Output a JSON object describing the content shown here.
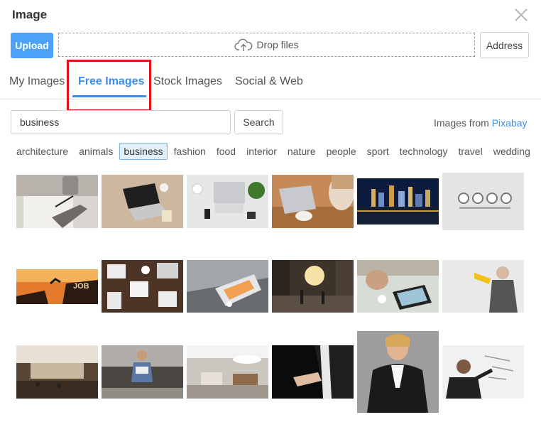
{
  "dialog": {
    "title": "Image"
  },
  "toolbar": {
    "upload_label": "Upload",
    "drop_label": "Drop files",
    "address_label": "Address"
  },
  "tabs": [
    {
      "label": "My Images"
    },
    {
      "label": "Free Images"
    },
    {
      "label": "Stock Images"
    },
    {
      "label": "Social & Web"
    }
  ],
  "active_tab": "Free Images",
  "search": {
    "value": "business",
    "button_label": "Search",
    "source_prefix": "Images from",
    "source_name": "Pixabay"
  },
  "categories": [
    "architecture",
    "animals",
    "business",
    "fashion",
    "food",
    "interior",
    "nature",
    "people",
    "sport",
    "technology",
    "travel",
    "wedding"
  ],
  "active_category": "business",
  "colors": {
    "accent": "#3a8ef0",
    "upload": "#4ba2f8",
    "highlight": "#e3131b"
  },
  "images": [
    {
      "subject": "hand-writing-notes"
    },
    {
      "subject": "laptop-on-desk"
    },
    {
      "subject": "workspace-top-view"
    },
    {
      "subject": "laptop-coffee"
    },
    {
      "subject": "city-skyline-night"
    },
    {
      "subject": "wall-clocks"
    },
    {
      "subject": "job-leap-sunset"
    },
    {
      "subject": "business-papers-desk"
    },
    {
      "subject": "keyboard-phone"
    },
    {
      "subject": "city-crowd"
    },
    {
      "subject": "tablet-meeting"
    },
    {
      "subject": "businessman-megaphone"
    },
    {
      "subject": "office-lobby"
    },
    {
      "subject": "man-on-sofa-laptop"
    },
    {
      "subject": "office-interior"
    },
    {
      "subject": "handshake"
    },
    {
      "subject": "businesswoman-portrait"
    },
    {
      "subject": "man-whiteboard"
    }
  ]
}
